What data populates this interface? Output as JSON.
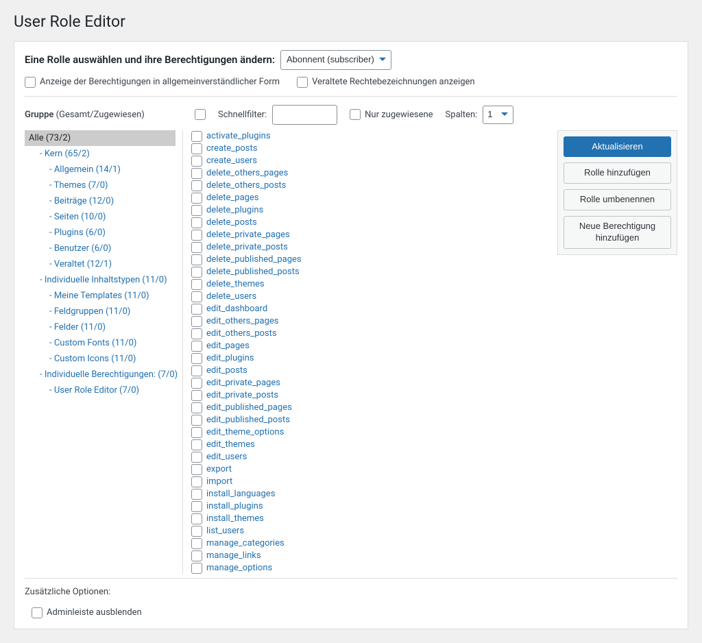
{
  "page_title": "User Role Editor",
  "role_select": {
    "label": "Eine Rolle auswählen und ihre Berechtigungen ändern:",
    "selected": "Abonnent (subscriber)"
  },
  "top_checkboxes": {
    "human_readable": "Anzeige der Berechtigungen in allgemeinverständlicher Form",
    "deprecated": "Veraltete Rechtebezeichnungen anzeigen"
  },
  "toolbar": {
    "group_label_bold": "Gruppe",
    "group_label_rest": " (Gesamt/Zugewiesen)",
    "quickfilter": "Schnellfilter:",
    "only_assigned": "Nur zugewiesene",
    "columns": "Spalten:",
    "columns_value": "1"
  },
  "tree": [
    {
      "label": "Alle (73/2)",
      "indent": 0,
      "selected": true
    },
    {
      "label": "- Kern (65/2)",
      "indent": 1
    },
    {
      "label": "- Allgemein (14/1)",
      "indent": 2
    },
    {
      "label": "- Themes (7/0)",
      "indent": 2
    },
    {
      "label": "- Beiträge (12/0)",
      "indent": 2
    },
    {
      "label": "- Seiten (10/0)",
      "indent": 2
    },
    {
      "label": "- Plugins (6/0)",
      "indent": 2
    },
    {
      "label": "- Benutzer (6/0)",
      "indent": 2
    },
    {
      "label": "- Veraltet (12/1)",
      "indent": 2
    },
    {
      "label": "- Individuelle Inhaltstypen (11/0)",
      "indent": 1
    },
    {
      "label": "- Meine Templates (11/0)",
      "indent": 2
    },
    {
      "label": "- Feldgruppen (11/0)",
      "indent": 2
    },
    {
      "label": "- Felder (11/0)",
      "indent": 2
    },
    {
      "label": "- Custom Fonts (11/0)",
      "indent": 2
    },
    {
      "label": "- Custom Icons (11/0)",
      "indent": 2
    },
    {
      "label": "- Individuelle Berechtigungen: (7/0)",
      "indent": 1
    },
    {
      "label": "- User Role Editor (7/0)",
      "indent": 2
    }
  ],
  "capabilities": [
    "activate_plugins",
    "create_posts",
    "create_users",
    "delete_others_pages",
    "delete_others_posts",
    "delete_pages",
    "delete_plugins",
    "delete_posts",
    "delete_private_pages",
    "delete_private_posts",
    "delete_published_pages",
    "delete_published_posts",
    "delete_themes",
    "delete_users",
    "edit_dashboard",
    "edit_others_pages",
    "edit_others_posts",
    "edit_pages",
    "edit_plugins",
    "edit_posts",
    "edit_private_pages",
    "edit_private_posts",
    "edit_published_pages",
    "edit_published_posts",
    "edit_theme_options",
    "edit_themes",
    "edit_users",
    "export",
    "import",
    "install_languages",
    "install_plugins",
    "install_themes",
    "list_users",
    "manage_categories",
    "manage_links",
    "manage_options"
  ],
  "actions": {
    "update": "Aktualisieren",
    "add_role": "Rolle hinzufügen",
    "rename_role": "Rolle umbenennen",
    "add_cap": "Neue Berechtigung hinzufügen"
  },
  "extra": {
    "title": "Zusätzliche Optionen:",
    "hide_adminbar": "Adminleiste ausblenden"
  }
}
